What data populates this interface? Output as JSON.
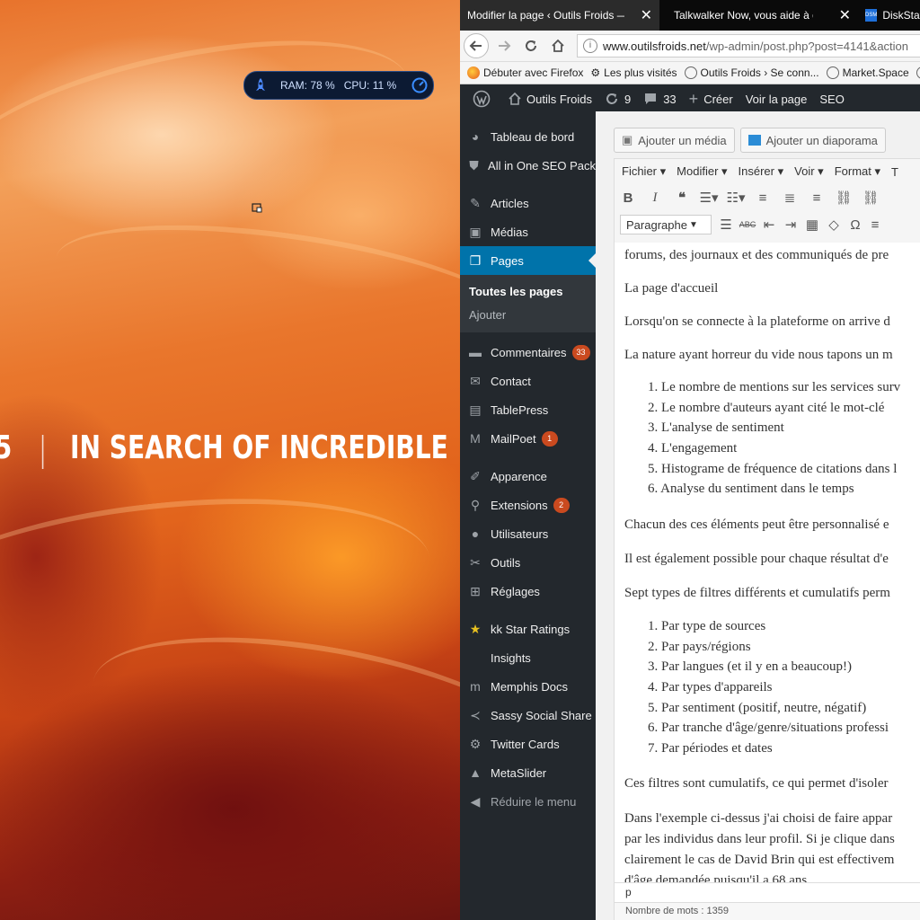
{
  "wallpaper": {
    "tagline_partial": "5",
    "tagline": "IN SEARCH OF INCREDIBLE"
  },
  "sysmon": {
    "ram": "RAM: 78 %",
    "cpu": "CPU: 11 %"
  },
  "tabs": [
    {
      "label": "Modifier la page ‹ Outils Froids — W",
      "active": true
    },
    {
      "label": "Talkwalker Now, vous aide à dé",
      "active": false
    },
    {
      "label": "DiskStation",
      "active": false
    }
  ],
  "nav": {
    "url_domain": "www.outilsfroids.net",
    "url_path": "/wp-admin/post.php?post=4141&action"
  },
  "bookmarks": [
    "Débuter avec Firefox",
    "Les plus visités",
    "Outils Froids › Se conn...",
    "Market.Space"
  ],
  "adminbar": {
    "site": "Outils Froids",
    "updates": "9",
    "comments": "33",
    "new": "Créer",
    "view": "Voir la page",
    "seo": "SEO"
  },
  "sidebar": {
    "dashboard": "Tableau de bord",
    "aioseo": "All in One SEO Pack",
    "articles": "Articles",
    "medias": "Médias",
    "pages": "Pages",
    "pages_all": "Toutes les pages",
    "pages_add": "Ajouter",
    "comments": "Commentaires",
    "comments_badge": "33",
    "contact": "Contact",
    "tablepress": "TablePress",
    "mailpoet": "MailPoet",
    "mailpoet_badge": "1",
    "appearance": "Apparence",
    "extensions": "Extensions",
    "extensions_badge": "2",
    "users": "Utilisateurs",
    "tools": "Outils",
    "settings": "Réglages",
    "kkstar": "kk Star Ratings",
    "insights": "Insights",
    "memphis": "Memphis Docs",
    "sassy": "Sassy Social Share",
    "twitter": "Twitter Cards",
    "metaslider": "MetaSlider",
    "collapse": "Réduire le menu"
  },
  "editor": {
    "add_media": "Ajouter un média",
    "add_slideshow": "Ajouter un diaporama",
    "menu": [
      "Fichier ▾",
      "Modifier ▾",
      "Insérer ▾",
      "Voir ▾",
      "Format ▾",
      "T"
    ],
    "format_select": "Paragraphe",
    "path": "p",
    "wordcount": "Nombre de mots : 1359"
  },
  "content": {
    "p1": "forums, des journaux et des communiqués de pre",
    "p2": "La page d'accueil",
    "p3": "Lorsqu'on se connecte à la plateforme on arrive d",
    "p4": "La nature ayant horreur du vide nous tapons un m",
    "list1": [
      "1. Le nombre de mentions sur les services surv",
      "2. Le nombre d'auteurs ayant cité le mot-clé",
      "3. L'analyse de sentiment",
      "4. L'engagement",
      "5. Histograme de fréquence de citations dans l",
      "6. Analyse du sentiment dans le temps"
    ],
    "p5": "Chacun des ces éléments peut être personnalisé e",
    "p6": "Il est également possible pour chaque résultat d'e",
    "p7": "Sept types de filtres différents et cumulatifs perm",
    "list2": [
      "1. Par type de sources",
      "2. Par pays/régions",
      "3. Par langues (et il y en a beaucoup!)",
      "4. Par types d'appareils",
      "5. Par sentiment (positif, neutre, négatif)",
      "6. Par tranche d'âge/genre/situations professi",
      "7. Par périodes et dates"
    ],
    "p8": "Ces filtres sont cumulatifs, ce qui permet d'isoler",
    "p9a": "Dans l'exemple ci-dessus j'ai choisi de faire appar",
    "p9b": "par les individus dans leur profil. Si je clique dans",
    "p9c": "clairement le cas de David Brin qui est effectivem",
    "p9d": "d'âge demandée puisqu'il a 68 ans"
  }
}
